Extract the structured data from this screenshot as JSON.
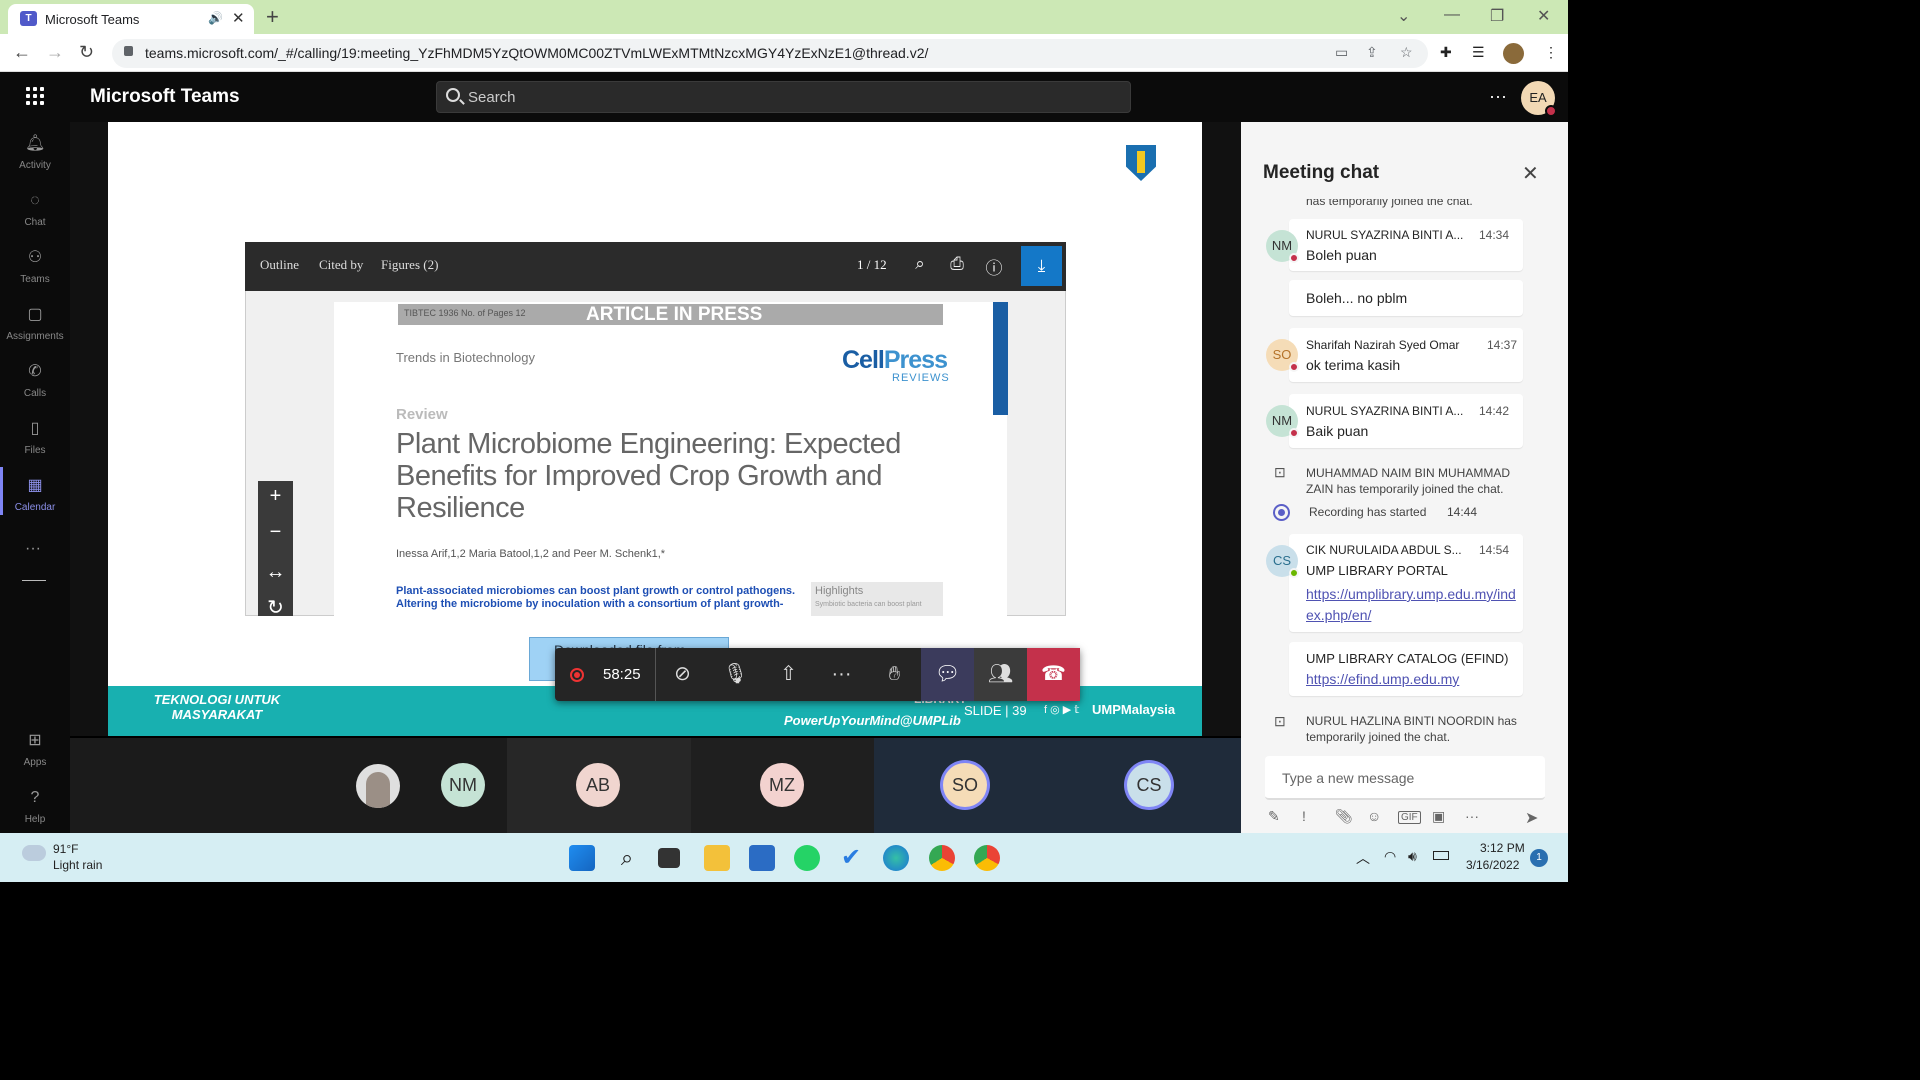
{
  "browser": {
    "tab_title": "Microsoft Teams",
    "url": "teams.microsoft.com/_#/calling/19:meeting_YzFhMDM5YzQtOWM0MC00ZTVmLWExMTMtNzcxMGY4YzExNzE1@thread.v2/"
  },
  "teams": {
    "app_name": "Microsoft Teams",
    "search_placeholder": "Search",
    "user_initials": "EA"
  },
  "rail": [
    {
      "label": "Activity"
    },
    {
      "label": "Chat"
    },
    {
      "label": "Teams"
    },
    {
      "label": "Assignments"
    },
    {
      "label": "Calls"
    },
    {
      "label": "Files"
    },
    {
      "label": "Calendar"
    },
    {
      "label": "Apps"
    },
    {
      "label": "Help"
    }
  ],
  "viewer": {
    "tabs": [
      "Outline",
      "Cited by",
      "Figures (2)"
    ],
    "page": "1 / 12"
  },
  "paper": {
    "code": "TIBTEC 1936 No. of Pages 12",
    "banner": "ARTICLE IN PRESS",
    "journal": "Trends in Biotechnology",
    "brand_cell": "Cell",
    "brand_press": "Press",
    "brand_reviews": "REVIEWS",
    "section": "Review",
    "title": "Plant Microbiome Engineering: Expected Benefits for Improved Crop Growth and Resilience",
    "authors": "Inessa Arif,1,2 Maria Batool,1,2 and Peer M. Schenk1,*",
    "abstract": "Plant-associated microbiomes can boost plant growth or control pathogens. Altering the microbiome by inoculation with a consortium of plant growth-",
    "highlights": "Highlights",
    "highlights_body": "Symbiotic bacteria can boost plant"
  },
  "slide": {
    "download_note": "Downloaded file from",
    "footer_left": "TEKNOLOGI UNTUK MASYARAKAT",
    "footer_library": "LIBRARY",
    "footer_tag": "PowerUpYourMind@UMPLib",
    "slide_label": "SLIDE | 39",
    "social": "UMPMalaysia"
  },
  "call": {
    "timer": "58:25"
  },
  "participants": [
    "NM",
    "AB",
    "MZ",
    "SO",
    "CS"
  ],
  "chat": {
    "title": "Meeting chat",
    "partial": "has temporarily joined the chat.",
    "messages": [
      {
        "initials": "NM",
        "name": "NURUL SYAZRINA BINTI A...",
        "time": "14:34",
        "body": "Boleh puan"
      },
      {
        "body": "Boleh... no pblm"
      },
      {
        "initials": "SO",
        "name": "Sharifah Nazirah Syed Omar",
        "time": "14:37",
        "body": "ok terima kasih"
      },
      {
        "initials": "NM",
        "name": "NURUL SYAZRINA BINTI A...",
        "time": "14:42",
        "body": "Baik puan"
      }
    ],
    "system1": "MUHAMMAD NAIM BIN MUHAMMAD ZAIN has temporarily joined the chat.",
    "recording": "Recording has started",
    "recording_time": "14:44",
    "portal": {
      "initials": "CS",
      "name": "CIK NURULAIDA ABDUL S...",
      "time": "14:54",
      "body": "UMP LIBRARY PORTAL",
      "link": "https://umplibrary.ump.edu.my/index.php/en/"
    },
    "catalog": {
      "body": "UMP LIBRARY CATALOG (EFIND)",
      "link": "https://efind.ump.edu.my"
    },
    "system2": "NURUL HAZLINA BINTI NOORDIN has temporarily joined the chat.",
    "compose_placeholder": "Type a new message"
  },
  "taskbar": {
    "temp": "91°F",
    "weather": "Light rain",
    "time": "3:12 PM",
    "date": "3/16/2022",
    "notifications": "1"
  }
}
